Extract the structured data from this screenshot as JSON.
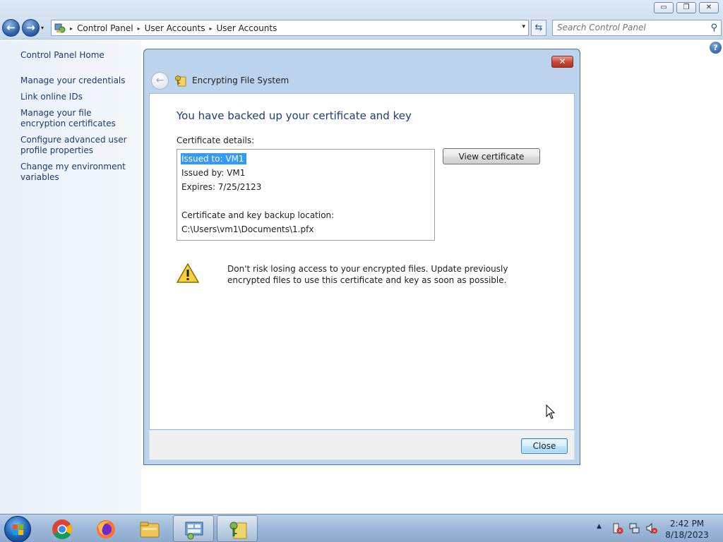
{
  "window": {
    "controls": {
      "minimize": "▭",
      "maximize": "❐",
      "close": "✕"
    }
  },
  "nav": {
    "back_glyph": "←",
    "forward_glyph": "→",
    "dropdown_glyph": "▾"
  },
  "address": {
    "breadcrumb": [
      "Control Panel",
      "User Accounts",
      "User Accounts"
    ],
    "separator": "▸",
    "dropdown_glyph": "▾",
    "refresh_glyph": "⇆"
  },
  "search": {
    "placeholder": "Search Control Panel",
    "icon": "search-icon",
    "icon_glyph": "⚲"
  },
  "sidebar": {
    "home": "Control Panel Home",
    "links": [
      {
        "label": "Manage your credentials"
      },
      {
        "label": "Link online IDs"
      },
      {
        "label": "Manage your file encryption certificates"
      },
      {
        "label": "Configure advanced user profile properties"
      },
      {
        "label": "Change my environment variables"
      }
    ]
  },
  "help": {
    "glyph": "?"
  },
  "dialog": {
    "title": "Encrypting File System",
    "close_glyph": "✕",
    "back_glyph": "←",
    "heading": "You have backed up your certificate and key",
    "details_label": "Certificate details:",
    "details": {
      "issued_to": "Issued to: VM1",
      "issued_by": "Issued by: VM1",
      "expires": "Expires: 7/25/2123",
      "blank": "",
      "location_label": "Certificate and key backup location:",
      "location": "C:\\Users\\vm1\\Documents\\1.pfx"
    },
    "view_certificate_label": "View certificate",
    "warning": "Don't risk losing access to your encrypted files. Update previously encrypted files to use this certificate and key as soon as possible.",
    "close_label": "Close"
  },
  "taskbar": {
    "items": [
      "chrome-icon",
      "firefox-icon",
      "explorer-icon",
      "control-panel-icon",
      "efs-key-icon"
    ],
    "tray_up_glyph": "▲",
    "time": "2:42 PM",
    "date": "8/18/2023"
  },
  "colors": {
    "accent": "#1d3d7c",
    "selection": "#3399ff",
    "link": "#1e3a6e"
  }
}
